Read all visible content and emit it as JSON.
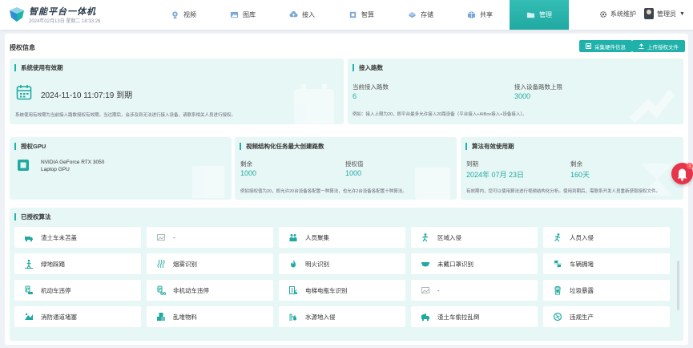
{
  "app": {
    "title": "智能平台一体机",
    "datetime": "2024年02月13日 星期二 18:33:26"
  },
  "nav": [
    {
      "label": "视频",
      "icon": "camera-icon"
    },
    {
      "label": "图库",
      "icon": "gallery-icon"
    },
    {
      "label": "接入",
      "icon": "cloud-upload-icon"
    },
    {
      "label": "智算",
      "icon": "chip-icon"
    },
    {
      "label": "存储",
      "icon": "storage-icon"
    },
    {
      "label": "共享",
      "icon": "share-icon"
    },
    {
      "label": "管理",
      "icon": "folder-icon",
      "active": true
    }
  ],
  "header": {
    "system_maintenance": "系统维护",
    "user": "管理员"
  },
  "page": {
    "title": "授权信息",
    "collect_hardware_btn": "采集硬件信息",
    "upload_license_btn": "上传授权文件"
  },
  "validity": {
    "title": "系统使用有效期",
    "date": "2024-11-10 11:07:19 到期",
    "note": "系统使用有效期为当前接入路数授权有效期，当过期后，会涉及到无法进行接入设备，请联系相关人员进行授权。"
  },
  "access": {
    "title": "接入路数",
    "current_label": "当前接入路数",
    "current_value": "6",
    "limit_label": "接入设备路数上限",
    "limit_value": "3000",
    "note": "例如：接入上限为20，即平台最多允许接入20路设备（平台接入+AIBox接入+设备接入）。"
  },
  "gpu": {
    "title": "授权GPU",
    "model_line1": "NVIDIA GeForce RTX 3050",
    "model_line2": "Laptop GPU"
  },
  "tasks": {
    "title": "视频结构化任务最大创建路数",
    "remain_label": "剩余",
    "remain_value": "1000",
    "auth_label": "授权值",
    "auth_value": "1000",
    "note": "例如授权值为20，即允许20台设备各配置一种算法，也允许2台设备各配置十种算法。"
  },
  "algo_validity": {
    "title": "算法有效使用期",
    "expire_label": "到期",
    "expire_value": "2024年 07月 23日",
    "remain_label": "剩余",
    "remain_value": "160天",
    "note": "有效期内，您可以使用算法进行视频结构化分析。使用到期后，需联系开发人员重新获取授权文件。"
  },
  "algorithms": {
    "title": "已授权算法",
    "items": [
      {
        "label": "渣土车未苫盖",
        "icon": "truck-icon"
      },
      {
        "label": "-",
        "icon": "image-icon"
      },
      {
        "label": "人员聚集",
        "icon": "crowd-icon"
      },
      {
        "label": "区域入侵",
        "icon": "intrusion-icon"
      },
      {
        "label": "人员入侵",
        "icon": "person-run-icon"
      },
      {
        "label": "绿地踩踏",
        "icon": "trample-icon"
      },
      {
        "label": "烟雾识别",
        "icon": "smoke-icon"
      },
      {
        "label": "明火识别",
        "icon": "fire-icon"
      },
      {
        "label": "未戴口罩识别",
        "icon": "mask-icon"
      },
      {
        "label": "车辆拥堵",
        "icon": "traffic-icon"
      },
      {
        "label": "机动车违停",
        "icon": "car-parking-icon"
      },
      {
        "label": "非机动车违停",
        "icon": "bike-parking-icon"
      },
      {
        "label": "电梯电瓶车识别",
        "icon": "elevator-icon"
      },
      {
        "label": "-",
        "icon": "image-icon"
      },
      {
        "label": "垃圾暴露",
        "icon": "trash-icon"
      },
      {
        "label": "消防通道堵塞",
        "icon": "fire-lane-icon"
      },
      {
        "label": "乱堆物料",
        "icon": "boxes-icon"
      },
      {
        "label": "水源地入侵",
        "icon": "water-icon"
      },
      {
        "label": "渣土车偷拉乱倒",
        "icon": "dump-truck-icon"
      },
      {
        "label": "违规生产",
        "icon": "violation-icon"
      }
    ]
  },
  "notification_badge": "1",
  "colors": {
    "accent": "#20b2aa",
    "card_bg": "#e7f7f6",
    "alert": "#e7344a"
  }
}
